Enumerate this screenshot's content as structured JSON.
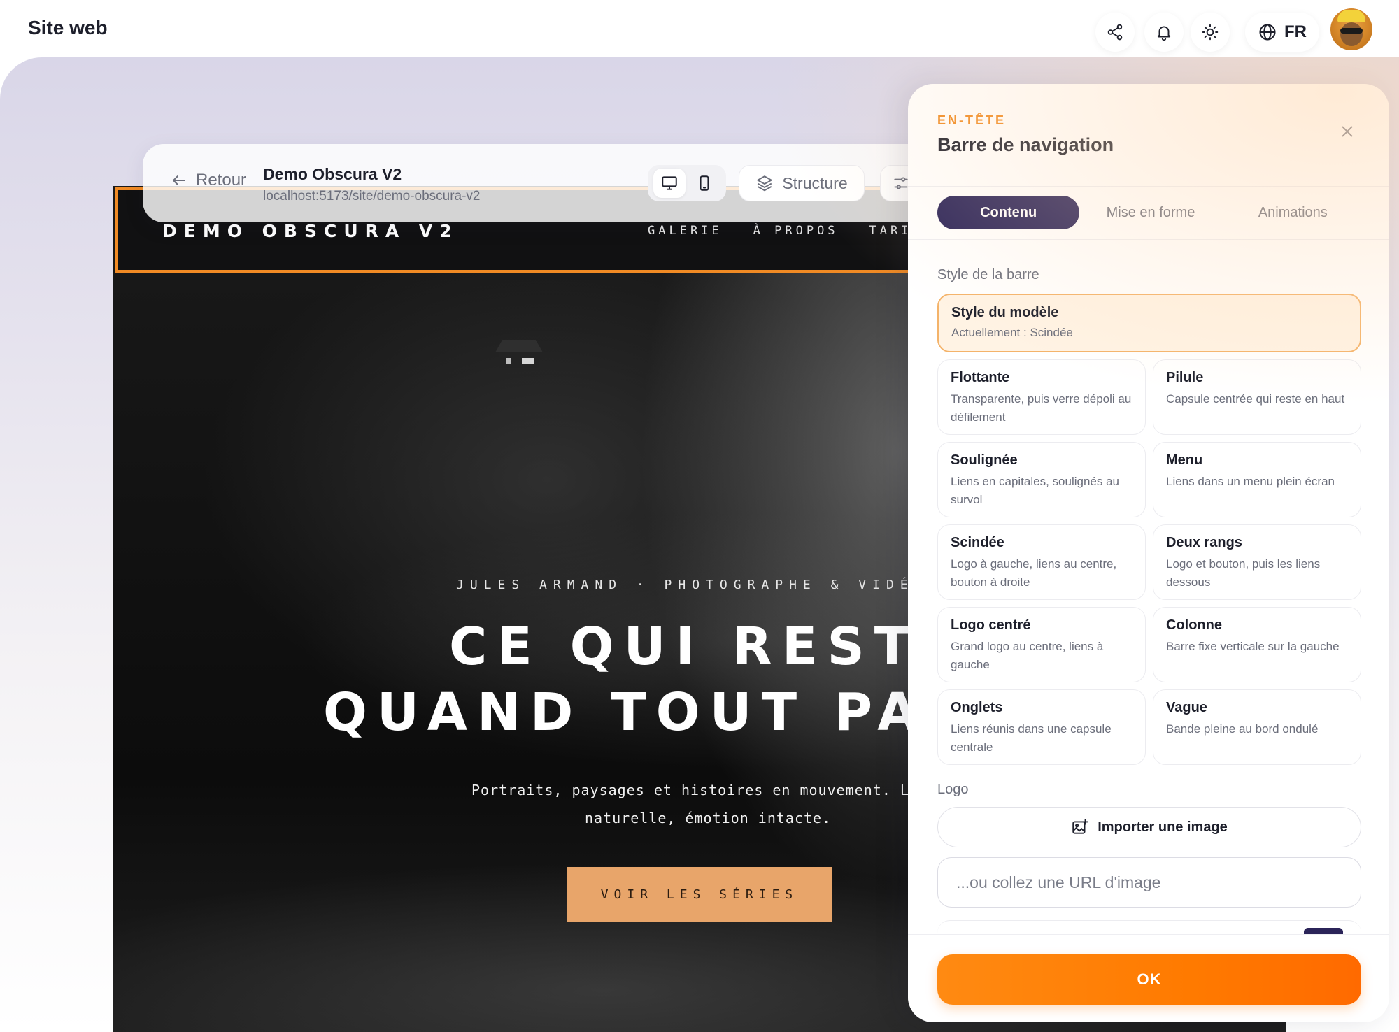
{
  "app": {
    "title": "Site web",
    "language": "FR"
  },
  "toolbar": {
    "back_label": "Retour",
    "site_name": "Demo Obscura V2",
    "site_url": "localhost:5173/site/demo-obscura-v2",
    "structure_label": "Structure"
  },
  "preview": {
    "logo": "DEMO OBSCURA V2",
    "nav_links": [
      "GALERIE",
      "À PROPOS",
      "TARIFS"
    ],
    "kicker": "JULES ARMAND · PHOTOGRAPHE & VIDÉAS",
    "headline_line1": "CE QUI REST",
    "headline_line2": "QUAND TOUT PA",
    "sub_line1": "Portraits, paysages et histoires en mouvement. Lumiè",
    "sub_line2": "naturelle, émotion intacte.",
    "cta": "VOIR LES SÉRIES"
  },
  "panel": {
    "kicker": "EN-TÊTE",
    "title": "Barre de navigation",
    "tabs": [
      {
        "label": "Contenu",
        "active": true
      },
      {
        "label": "Mise en forme",
        "active": false
      },
      {
        "label": "Animations",
        "active": false
      }
    ],
    "style_section_label": "Style de la barre",
    "featured_option": {
      "title": "Style du modèle",
      "desc": "Actuellement : Scindée"
    },
    "options": [
      {
        "title": "Flottante",
        "desc": "Transparente, puis verre dépoli au défilement"
      },
      {
        "title": "Pilule",
        "desc": "Capsule centrée qui reste en haut"
      },
      {
        "title": "Soulignée",
        "desc": "Liens en capitales, soulignés au survol"
      },
      {
        "title": "Menu",
        "desc": "Liens dans un menu plein écran"
      },
      {
        "title": "Scindée",
        "desc": "Logo à gauche, liens au centre, bouton à droite"
      },
      {
        "title": "Deux rangs",
        "desc": "Logo et bouton, puis les liens dessous"
      },
      {
        "title": "Logo centré",
        "desc": "Grand logo au centre, liens à gauche"
      },
      {
        "title": "Colonne",
        "desc": "Barre fixe verticale sur la gauche"
      },
      {
        "title": "Onglets",
        "desc": "Liens réunis dans une capsule centrale"
      },
      {
        "title": "Vague",
        "desc": "Bande pleine au bord ondulé"
      }
    ],
    "logo_section_label": "Logo",
    "upload_label": "Importer une image",
    "url_placeholder": "...ou collez une URL d'image",
    "ok_label": "OK"
  },
  "colors": {
    "accent_orange": "#ff7a00",
    "tab_active": "#2b2459",
    "featured_bg": "#fff3e4",
    "cta_bg": "#e8a56a"
  }
}
